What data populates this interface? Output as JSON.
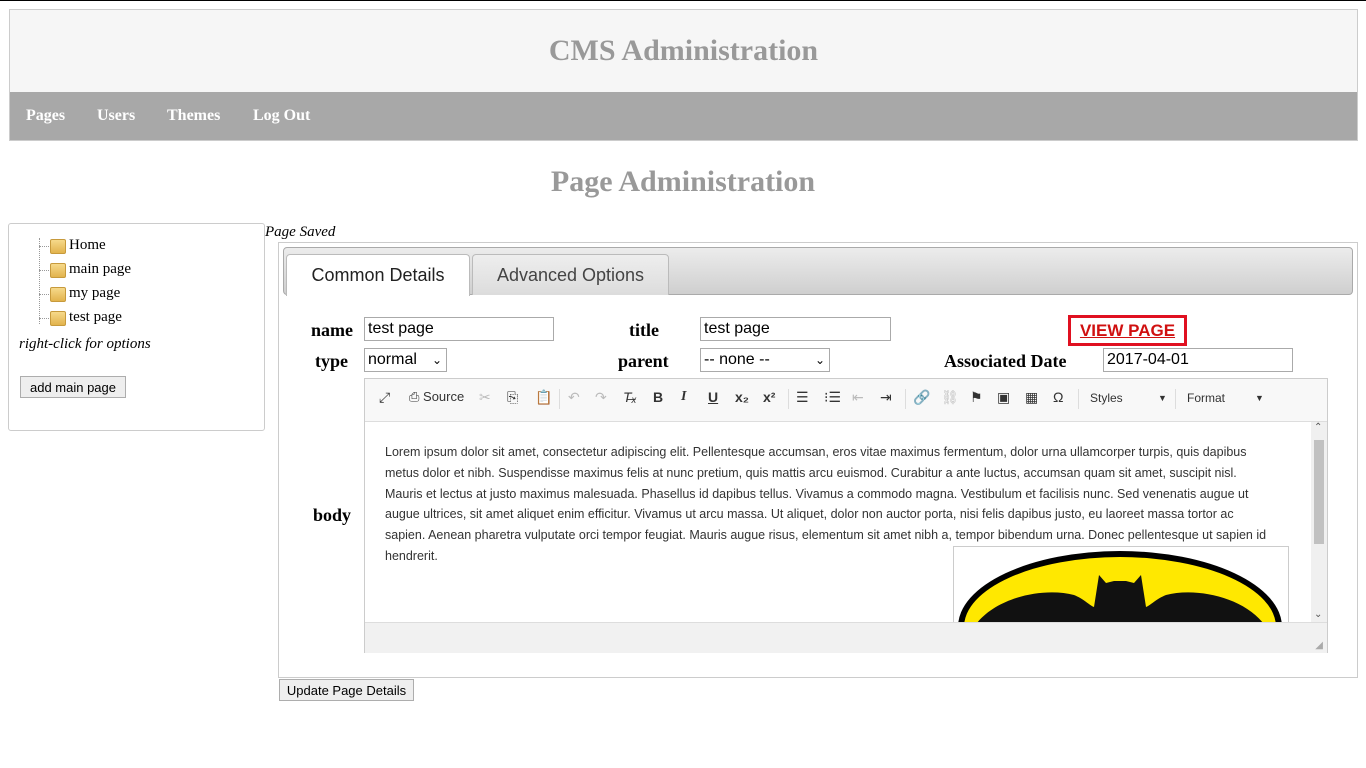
{
  "header": {
    "title": "CMS Administration"
  },
  "nav": [
    {
      "label": "Pages"
    },
    {
      "label": "Users"
    },
    {
      "label": "Themes"
    },
    {
      "label": "Log Out"
    }
  ],
  "page_title": "Page Administration",
  "tree": {
    "items": [
      {
        "label": "Home"
      },
      {
        "label": "main page"
      },
      {
        "label": "my page"
      },
      {
        "label": "test page"
      }
    ],
    "hint": "right-click for options",
    "add_button": "add main page"
  },
  "status_message": "Page Saved",
  "tabs": [
    {
      "label": "Common Details"
    },
    {
      "label": "Advanced Options"
    }
  ],
  "form": {
    "name_label": "name",
    "name_value": "test page",
    "title_label": "title",
    "title_value": "test page",
    "view_page": "VIEW PAGE",
    "type_label": "type",
    "type_value": "normal",
    "parent_label": "parent",
    "parent_value": "-- none --",
    "date_label": "Associated Date",
    "date_value": "2017-04-01",
    "body_label": "body"
  },
  "editor": {
    "source_label": "Source",
    "styles_label": "Styles",
    "format_label": "Format",
    "body_text": "Lorem ipsum dolor sit amet, consectetur adipiscing elit. Pellentesque accumsan, eros vitae maximus fermentum, dolor urna ullamcorper turpis, quis dapibus metus dolor et nibh. Suspendisse maximus felis at nunc pretium, quis mattis arcu euismod. Curabitur a ante luctus, accumsan quam sit amet, suscipit nisl. Mauris et lectus at justo maximus malesuada. Phasellus id dapibus tellus. Vivamus a commodo magna. Vestibulum et facilisis nunc. Sed venenatis augue ut augue ultrices, sit amet aliquet enim efficitur. Vivamus ut arcu massa. Ut aliquet, dolor non auctor porta, nisi felis dapibus justo, eu laoreet massa tortor ac sapien. Aenean pharetra vulputate orci tempor feugiat. Mauris augue risus, elementum sit amet nibh a, tempor bibendum urna. Donec pellentesque ut sapien id hendrerit."
  },
  "update_button": "Update Page Details",
  "colors": {
    "accent_red": "#e01020",
    "nav_bg": "#a8a8a8",
    "title_gray": "#999999",
    "batman_yellow": "#ffe800"
  }
}
